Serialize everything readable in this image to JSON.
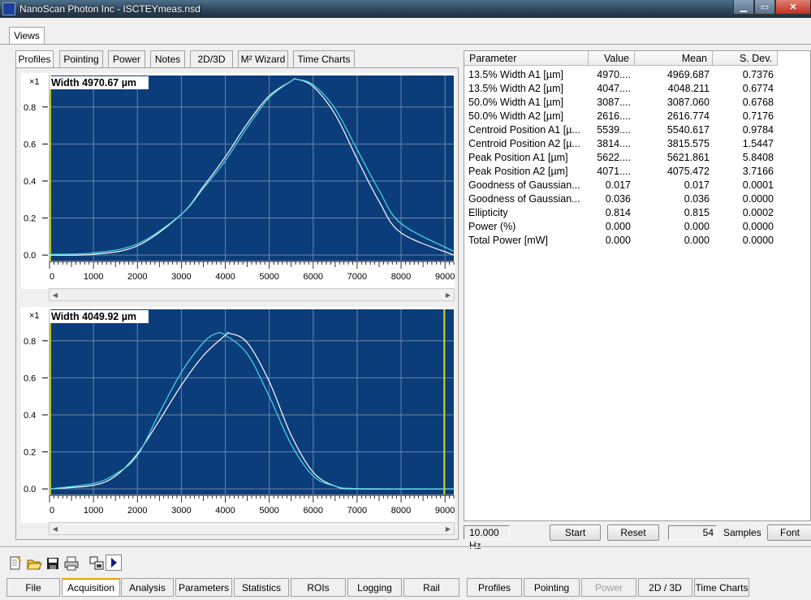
{
  "window": {
    "title": "NanoScan Photon Inc - ISCTEYmeas.nsd"
  },
  "views_tab": "Views",
  "view_tabs": [
    "Profiles",
    "Pointing",
    "Power",
    "Notes",
    "2D/3D",
    "M² Wizard",
    "Time Charts"
  ],
  "charts": {
    "top": {
      "label": "Width 4970.67 µm",
      "scale_label": "×1"
    },
    "bottom": {
      "label": "Width 4049.92 µm",
      "scale_label": "×1"
    }
  },
  "chart_data": [
    {
      "type": "line",
      "title": "Width 4970.67 µm",
      "xlim": [
        0,
        9200
      ],
      "ylim": [
        -0.03,
        0.97
      ],
      "x_ticks": [
        "0",
        "1000",
        "2000",
        "3000",
        "4000",
        "5000",
        "6000",
        "7000",
        "8000",
        "9000"
      ],
      "y_ticks": [
        "0.0",
        "0.2",
        "0.4",
        "0.6",
        "0.8"
      ],
      "grid": true,
      "series": [
        {
          "color": "#ffffff",
          "x": [
            0,
            1000,
            2000,
            3000,
            3500,
            4000,
            4500,
            5000,
            5500,
            5620,
            6000,
            6500,
            7000,
            7500,
            8000,
            9200
          ],
          "y": [
            0.0,
            0.004,
            0.05,
            0.22,
            0.37,
            0.53,
            0.71,
            0.86,
            0.94,
            0.95,
            0.91,
            0.76,
            0.52,
            0.29,
            0.12,
            0.0
          ]
        },
        {
          "color": "#4fd8e8",
          "x": [
            0,
            1000,
            2000,
            3000,
            3500,
            4000,
            4500,
            5000,
            5500,
            5600,
            6000,
            6500,
            7000,
            7500,
            8000,
            9200
          ],
          "y": [
            0.004,
            0.012,
            0.06,
            0.22,
            0.36,
            0.51,
            0.69,
            0.85,
            0.94,
            0.95,
            0.92,
            0.79,
            0.57,
            0.35,
            0.17,
            0.02
          ]
        }
      ]
    },
    {
      "type": "line",
      "title": "Width 4049.92 µm",
      "xlim": [
        0,
        9200
      ],
      "ylim": [
        -0.03,
        0.97
      ],
      "x_ticks": [
        "0",
        "1000",
        "2000",
        "3000",
        "4000",
        "5000",
        "6000",
        "7000",
        "8000",
        "9000"
      ],
      "y_ticks": [
        "0.0",
        "0.2",
        "0.4",
        "0.6",
        "0.8"
      ],
      "grid": true,
      "series": [
        {
          "color": "#ffffff",
          "x": [
            0,
            1000,
            1500,
            2000,
            2500,
            3000,
            3500,
            4000,
            4100,
            4500,
            5000,
            5500,
            6000,
            6500,
            7000,
            9200
          ],
          "y": [
            0.0,
            0.02,
            0.07,
            0.19,
            0.37,
            0.56,
            0.72,
            0.83,
            0.84,
            0.79,
            0.58,
            0.29,
            0.09,
            0.015,
            0.0,
            0.0
          ]
        },
        {
          "color": "#4fd8e8",
          "x": [
            0,
            1000,
            1500,
            2000,
            2500,
            3000,
            3500,
            3800,
            4000,
            4500,
            5000,
            5500,
            6000,
            6500,
            7000,
            9200
          ],
          "y": [
            0.0,
            0.03,
            0.08,
            0.18,
            0.41,
            0.63,
            0.79,
            0.84,
            0.83,
            0.73,
            0.5,
            0.24,
            0.07,
            0.015,
            0.002,
            0.0
          ]
        }
      ]
    }
  ],
  "table": {
    "headers": [
      "Parameter",
      "Value",
      "Mean",
      "S. Dev."
    ],
    "rows": [
      [
        "13.5% Width A1 [µm]",
        "4970....",
        "4969.687",
        "0.7376"
      ],
      [
        "13.5% Width A2 [µm]",
        "4047....",
        "4048.211",
        "0.6774"
      ],
      [
        "50.0% Width A1 [µm]",
        "3087....",
        "3087.060",
        "0.6768"
      ],
      [
        "50.0% Width A2 [µm]",
        "2616....",
        "2616.774",
        "0.7176"
      ],
      [
        "Centroid Position A1 [µ...",
        "5539....",
        "5540.617",
        "0.9784"
      ],
      [
        "Centroid Position A2 [µ...",
        "3814....",
        "3815.575",
        "1.5447"
      ],
      [
        "Peak Position A1 [µm]",
        "5622....",
        "5621.861",
        "5.8408"
      ],
      [
        "Peak Position A2 [µm]",
        "4071....",
        "4075.472",
        "3.7166"
      ],
      [
        "Goodness of Gaussian...",
        "0.017",
        "0.017",
        "0.0001"
      ],
      [
        "Goodness of Gaussian...",
        "0.036",
        "0.036",
        "0.0000"
      ],
      [
        "Ellipticity",
        "0.814",
        "0.815",
        "0.0002"
      ],
      [
        "Power (%)",
        "0.000",
        "0.000",
        "0.0000"
      ],
      [
        "Total Power [mW]",
        "0.000",
        "0.000",
        "0.0000"
      ]
    ]
  },
  "status": {
    "frequency": "10.000 Hz",
    "start": "Start",
    "reset": "Reset",
    "samples_count": "54",
    "samples_label": "Samples",
    "font": "Font"
  },
  "bottom_tabs": [
    "File",
    "Acquisition",
    "Analysis",
    "Parameters",
    "Statistics",
    "ROIs",
    "Logging",
    "Rail"
  ],
  "view_buttons": [
    "Profiles",
    "Pointing",
    "Power",
    "2D / 3D",
    "Time Charts"
  ]
}
